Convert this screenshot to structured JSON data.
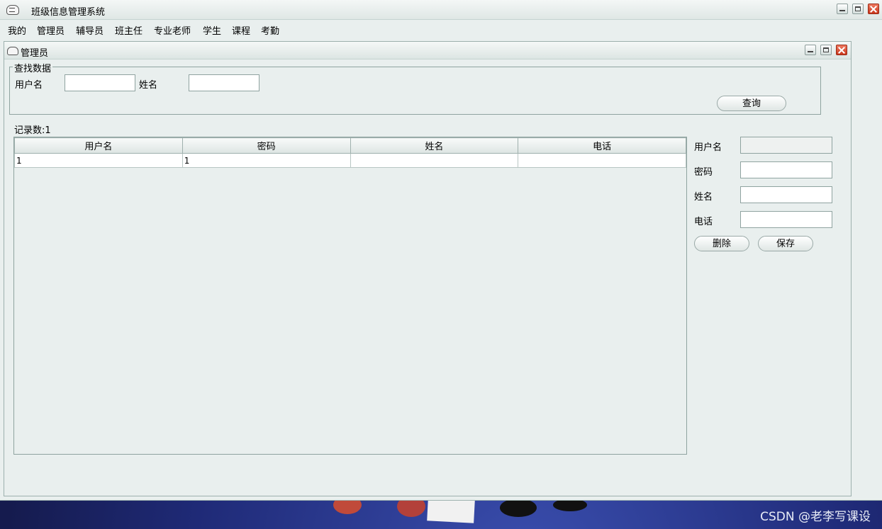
{
  "app": {
    "title": "班级信息管理系统"
  },
  "menu": [
    {
      "label": "我的"
    },
    {
      "label": "管理员"
    },
    {
      "label": "辅导员"
    },
    {
      "label": "班主任"
    },
    {
      "label": "专业老师"
    },
    {
      "label": "学生"
    },
    {
      "label": "课程"
    },
    {
      "label": "考勤"
    }
  ],
  "frame": {
    "title": "管理员"
  },
  "search": {
    "legend": "查找数据",
    "username_label": "用户名",
    "username_value": "",
    "name_label": "姓名",
    "name_value": "",
    "query_button": "查询"
  },
  "records": {
    "count_label": "记录数:1"
  },
  "table": {
    "columns": [
      "用户名",
      "密码",
      "姓名",
      "电话"
    ],
    "rows": [
      [
        "1",
        "1",
        "",
        ""
      ]
    ]
  },
  "detail": {
    "username_label": "用户名",
    "username_value": "",
    "password_label": "密码",
    "password_value": "",
    "name_label": "姓名",
    "name_value": "",
    "phone_label": "电话",
    "phone_value": "",
    "delete_button": "删除",
    "save_button": "保存"
  },
  "watermark": "CSDN @老李写课设"
}
